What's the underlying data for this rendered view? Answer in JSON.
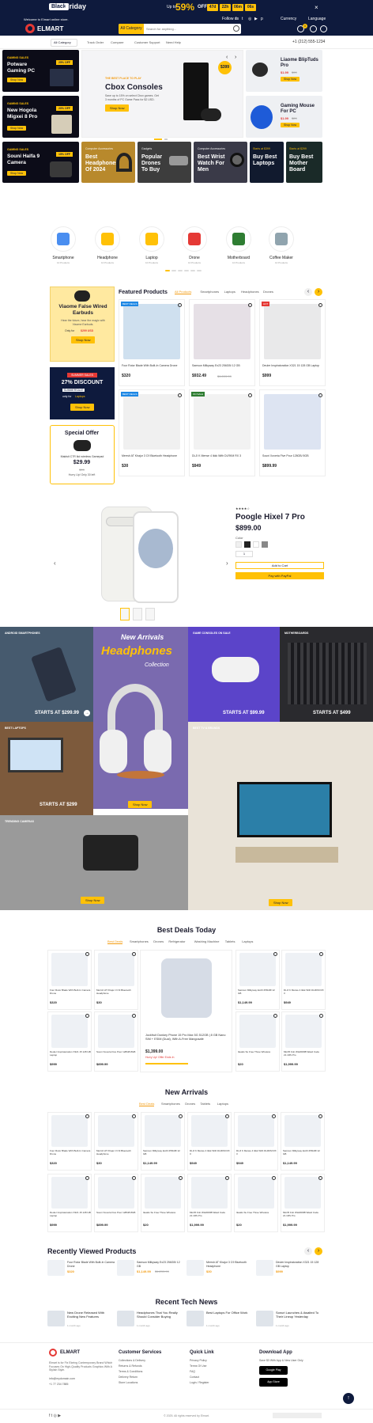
{
  "topbar": {
    "black": "Black",
    "friday": "Friday",
    "up_to": "Up to",
    "percent": "59%",
    "off": "OFF",
    "countdown": [
      "47d",
      "22h",
      "06m",
      "06s"
    ],
    "welcome": "Welcome to Elmart online store.",
    "follow": "Follow us",
    "currency": "Currency",
    "language": "Language"
  },
  "brand": {
    "name": "ELMART"
  },
  "search": {
    "category": "All Category",
    "placeholder": "Search for anything..."
  },
  "cart": {
    "count": "0",
    "total": "$0"
  },
  "subnav": {
    "all_category": "All Category",
    "items": [
      "Track Order",
      "Compare",
      "Customer Support",
      "Need Help"
    ],
    "phone": "+1 (212) 555-1234"
  },
  "promos_left": [
    {
      "tag": "GAMING SALES",
      "title": "Potware Gaming PC",
      "badge": "25% OFF",
      "btn": "Shop Now"
    },
    {
      "tag": "GAMING SALES",
      "title": "New Hogola Migxei 8 Pro",
      "badge": "20% OFF",
      "btn": "Shop Now"
    },
    {
      "tag": "GAMING SALES",
      "title": "Souni Halfa 9 Camera",
      "badge": "15% OFF",
      "btn": "Shop Now"
    }
  ],
  "hero": {
    "tag": "THE BEST PLACE TO PLAY",
    "title": "Cbox Consoles",
    "desc": "Save up to 15% on select Cbox games. Get 3 months of PC Game Pass for $2 USD.",
    "btn": "Shop Now",
    "price": "$399"
  },
  "promos_right": [
    {
      "title": "Liaome BlipTuds Pro",
      "price": "$1.99",
      "old": "$99",
      "btn": "Shop Now"
    },
    {
      "title": "Gaming Mouse For PC",
      "price": "$1.99",
      "old": "$29",
      "btn": "Shop Now"
    }
  ],
  "strip": [
    {
      "tag": "Computer Accessories",
      "title": "Best Headphones Of 2024"
    },
    {
      "tag": "Gadgets",
      "title": "Popular Drones To Buy"
    },
    {
      "tag": "Computer Accessories",
      "title": "Best Wrist Watch For Men"
    },
    {
      "tag": "Starts at $399",
      "title": "Buy Best Laptops"
    },
    {
      "tag": "Starts at $299",
      "title": "Buy Best Mother Board"
    }
  ],
  "categories": [
    {
      "name": "Smartphone",
      "count": "10 Products",
      "icon": "smartphone-icon"
    },
    {
      "name": "Headphone",
      "count": "10 Products",
      "icon": "headphone-icon"
    },
    {
      "name": "Laptop",
      "count": "10 Products",
      "icon": "laptop-icon"
    },
    {
      "name": "Drone",
      "count": "10 Products",
      "icon": "drone-icon"
    },
    {
      "name": "Motherboard",
      "count": "10 Products",
      "icon": "motherboard-icon"
    },
    {
      "name": "Coffee Maker",
      "count": "10 Products",
      "icon": "coffee-maker-icon"
    }
  ],
  "featured": {
    "title": "Featured Products",
    "tabs": [
      "All Products",
      "Smartphones",
      "Laptops",
      "Headphones",
      "Drones"
    ],
    "products": [
      {
        "name": "Four Rotor Blade With Built-In Camera Drone",
        "price": "$320",
        "old": "",
        "badge": "BEST DEALS"
      },
      {
        "name": "Samsun Milkyway Ex23 256GB/ 12 GB",
        "price": "$932.49",
        "old": "$1,099.99",
        "badge": ""
      },
      {
        "name": "Deuler Inspiratoration X321 15 128 GB Laptop",
        "price": "$999",
        "old": "",
        "badge": "HOT"
      },
      {
        "name": "Merrsh AT Khajur 3 C9 Bluetooth Headphone",
        "price": "$30",
        "old": "",
        "badge": "BEST DEALS"
      },
      {
        "name": "DLJI K Merwe 4 Ikkk With DLRKM RX 3",
        "price": "$949",
        "old": "",
        "badge": "ON SALE"
      },
      {
        "name": "Souni Xoveria Five Pour 128GB/ 8GB",
        "price": "$899.99",
        "old": "",
        "badge": ""
      }
    ]
  },
  "left_side": {
    "earbuds": {
      "title": "Viaome False Wired Earbuds",
      "desc": "Hear the future, hear the magic with Viaome Earbuds.",
      "only_for": "Only for",
      "price": "$299 USD",
      "btn": "Shop Now"
    },
    "summer": {
      "tag": "SUMMER SALES",
      "title": "27% DISCOUNT",
      "code_label": "SUMMERSALE",
      "only_for": "only for",
      "item": "Laptops",
      "btn": "Shop Now"
    },
    "special": {
      "title": "Special Offer",
      "item": "Maidsit C7R Ikd wireless Gamepad",
      "price": "$29.99",
      "old": "$99",
      "deal": "Hurry Up! Only 30 left"
    }
  },
  "pixel": {
    "rating": "4",
    "title": "Poogle Hixel 7 Pro",
    "price": "$899.00",
    "color_label": "Color",
    "qty": "1",
    "add_cart": "Add to Cart",
    "buy_now": "Pay with PayPal"
  },
  "banners": [
    {
      "tag": "ANDROID SMARTPHONES",
      "start": "STARTS AT $299.99"
    },
    {
      "tag": "New Arrivals",
      "title": "Headphones",
      "sub": "Collection",
      "btn": "Shop Now"
    },
    {
      "tag": "GAME CONSOLES ON SALE",
      "start": "STARTS AT $99.99"
    },
    {
      "tag": "MOTHERBOARDS",
      "start": "STARTS AT $499"
    },
    {
      "tag": "BEST LAPTOPS",
      "start": "STARTS AT $299"
    },
    {
      "tag": "BEST TV & BRANDS",
      "btn": "Shop Now"
    },
    {
      "tag": "TRENDING CAMERAS",
      "btn": "Shop Now"
    }
  ],
  "best_deals": {
    "title": "Best Deals Today",
    "tabs": [
      "Best Deals",
      "Smartphones",
      "Drones",
      "Refrigerator",
      "Washing Machine",
      "Tablets",
      "Laptops"
    ],
    "items": [
      {
        "name": "Four Rotor Blade With Built-In Camera Drone",
        "price": "$320"
      },
      {
        "name": "Merrsh AT Khajur 3 C9 Bluetooth Headphone",
        "price": "$30"
      },
      {
        "name": "Samsun Milkyway Ex23 256GB/ 12 GB",
        "price": "$1,149.99"
      },
      {
        "name": "DLJI K Merwe 4 Ikkk With DLRKM RX 3",
        "price": "$949"
      },
      {
        "name": "Deuler Inspiratoration X321 15 128 GB Laptop",
        "price": "$999"
      },
      {
        "name": "Souni Xoveria Five Pour 128GB 8GB",
        "price": "$899.99"
      },
      {
        "name": "Ikeatis Su Free Three Wireless",
        "price": "$20"
      },
      {
        "name": "Micrfft Fob WH2009B Wasd Code 21.1RS Pro",
        "price": "$1,999.99"
      }
    ],
    "center": {
      "name": "Jockfruit Donkey Phone 15 Pro Max 5G 512GB | 8 GB Nano SIM + ESIM (Dual), With A-Free Mangosafe",
      "price": "$1,399.00",
      "deal": "Hurry Up! Offer Ends In"
    }
  },
  "new_arrivals": {
    "title": "New Arrivals",
    "tabs": [
      "Best Deals",
      "Smartphones",
      "Drones",
      "Tablets",
      "Laptops"
    ],
    "items": [
      {
        "name": "Four Rotor Blade With Built-In Camera Drone",
        "price": "$320"
      },
      {
        "name": "Merrsh AT Khajur 3 C9 Bluetooth Headphone",
        "price": "$30"
      },
      {
        "name": "Samsun Milkyway Ex23 256GB/ 12 GB",
        "price": "$1,149.99"
      },
      {
        "name": "DLJI K Merwe 4 Ikkk With DLRKM RX 3",
        "price": "$949"
      },
      {
        "name": "DLJI K Merwe 4 Ikkk With DLRKM RX 3",
        "price": "$949"
      },
      {
        "name": "Samsun Milkyway Ex23 256GB/ 12 GB",
        "price": "$1,149.99"
      },
      {
        "name": "Deuler Inspiratoration X321 15 128 GB Laptop",
        "price": "$999"
      },
      {
        "name": "Souni Xoveria Five Pour 128GB 8GB",
        "price": "$899.99"
      },
      {
        "name": "Ikeatis Su Free Three Wireless",
        "price": "$20"
      },
      {
        "name": "Micrfft Fob WH2009B Wasd Code 21.1RS Pro",
        "price": "$1,999.99"
      },
      {
        "name": "Ikeatis Su Free Three Wireless",
        "price": "$20"
      },
      {
        "name": "Micrfft Fob WH2009B Wasd Code 21.1RS Pro",
        "price": "$1,999.99"
      }
    ]
  },
  "recently": {
    "title": "Recently Viewed Products",
    "items": [
      {
        "name": "Four Rotor Blade With Built-In Camera Drone",
        "price": "$320"
      },
      {
        "name": "Samsun Milkyway Ex23 256GB/ 12 GB",
        "price": "$1,149.99",
        "old": "$1,299.99"
      },
      {
        "name": "Merrsh AT Khajur 3 C9 Bluetooth Headphone",
        "price": "$30"
      },
      {
        "name": "Deuler Inspiratoration X321 15 128 GB Laptop",
        "price": "$999"
      }
    ]
  },
  "news": {
    "title": "Recent Tech News",
    "items": [
      {
        "title": "New Drone Released With Exciting New Features",
        "date": "1 month ago"
      },
      {
        "title": "Headphones That You Really Should Consider Buying",
        "date": "1 month ago"
      },
      {
        "title": "Best Laptops For Office Work",
        "date": "1 month ago"
      },
      {
        "title": "Sonuri Launches & Awaited To Their Lineup Yesterday",
        "date": "1 month ago"
      }
    ]
  },
  "footer": {
    "desc": "Elmart is for Fix Ekeing Contemporary Brand Which Focuses On High-Quality Products Graphics With A Stylish Style.",
    "email": "info@mydomain.com",
    "phone": "+1 77 234 7885",
    "customer": {
      "title": "Customer Services",
      "links": [
        "Collections & Delivery",
        "Returns & Refunds",
        "Terms & Conditions",
        "Delivery Return",
        "Store Locations"
      ]
    },
    "quick": {
      "title": "Quick Link",
      "links": [
        "Privacy Policy",
        "Terms Of Use",
        "FAQ",
        "Contact",
        "Login / Register"
      ]
    },
    "app": {
      "title": "Download App",
      "desc": "Save $3 With App & New User Only",
      "google": "Google Play",
      "apple": "App Store"
    },
    "copyright": "© 2025. All rights reserved by Elmart."
  },
  "colors": {
    "navy": "#0e1a3d",
    "accent": "#ffc107",
    "red": "#e53935"
  }
}
